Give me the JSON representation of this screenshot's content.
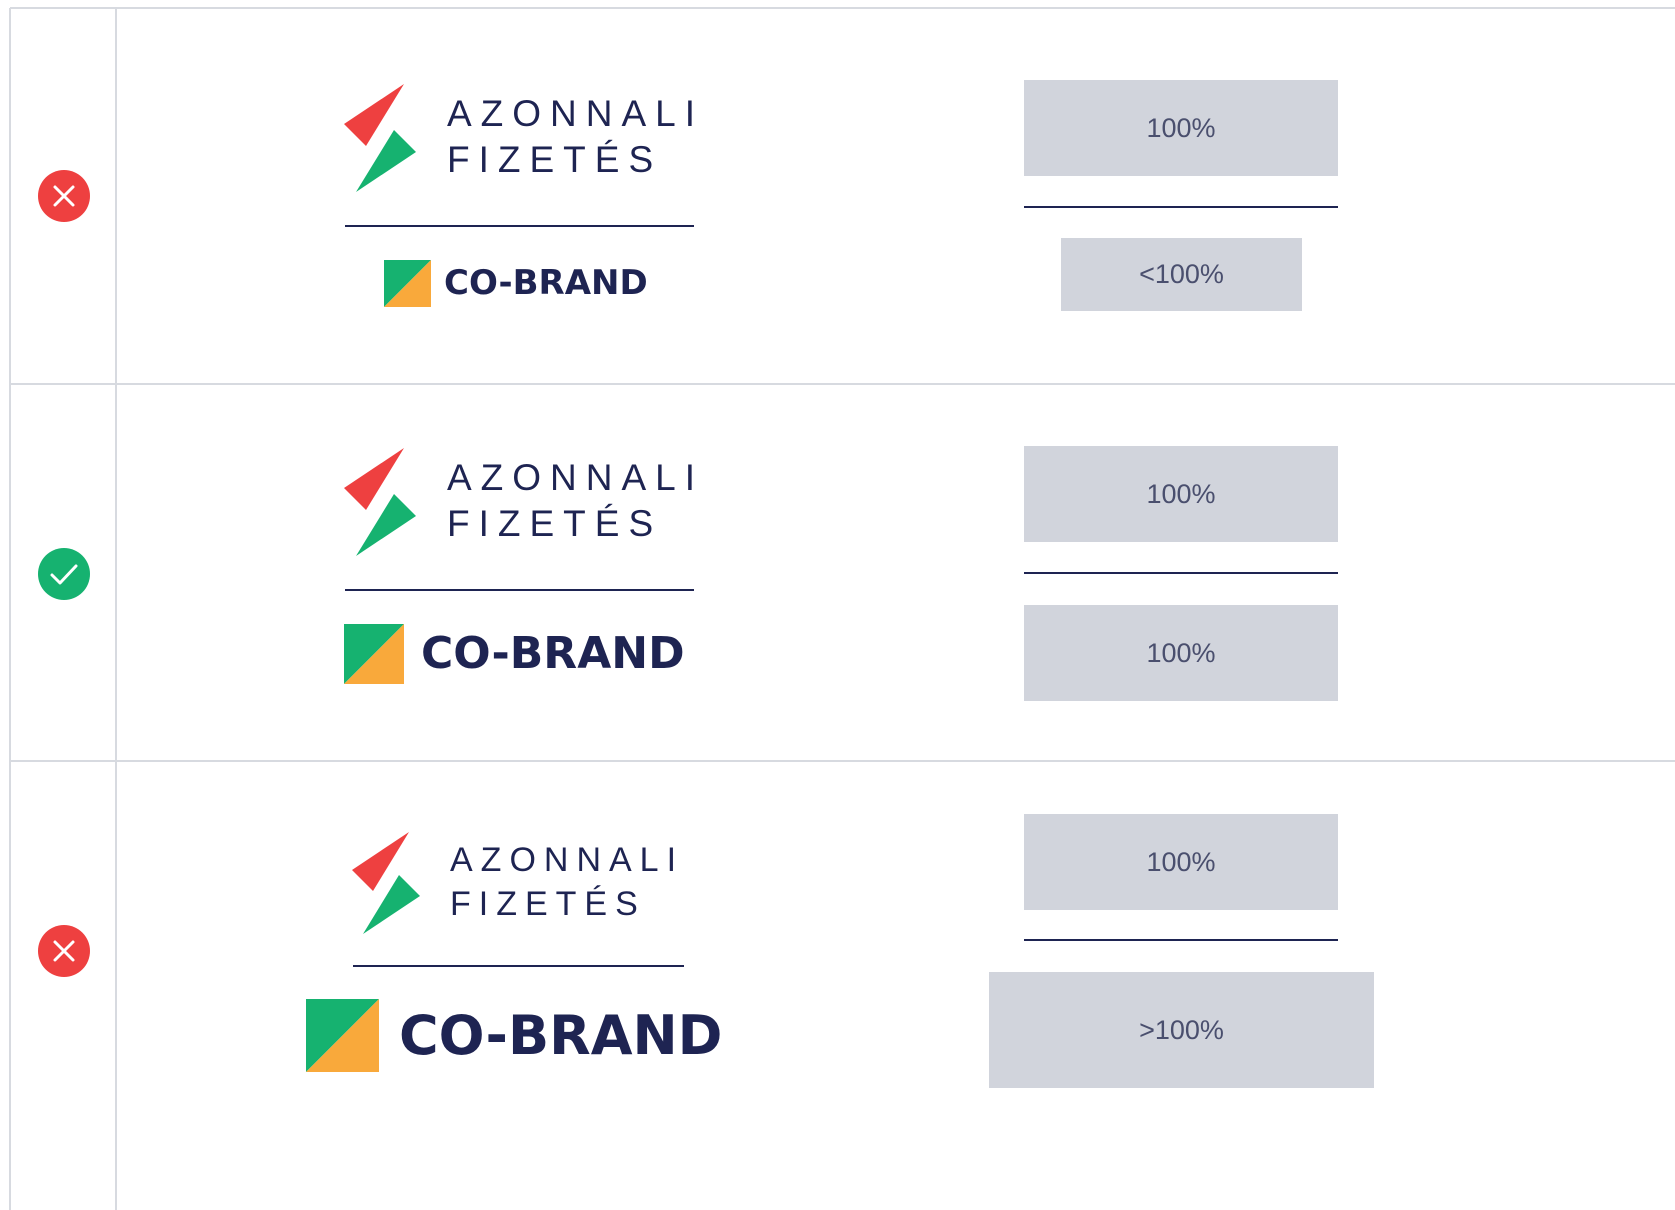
{
  "colors": {
    "error": "#ee4040",
    "success": "#16b270",
    "navy": "#1e2452",
    "box_fill": "#d1d4dc",
    "grid": "#d7dae0",
    "mark_red": "#ee4040",
    "mark_green": "#16b270",
    "mark_orange": "#f9a93b"
  },
  "rows": [
    {
      "status": "incorrect",
      "status_icon": "x-icon",
      "primary_logo": {
        "line1": "AZONNALI",
        "line2": "FIZETÉS"
      },
      "cobrand_text": "CO-BRAND",
      "box_top_label": "100%",
      "box_bottom_label": "<100%"
    },
    {
      "status": "correct",
      "status_icon": "check-icon",
      "primary_logo": {
        "line1": "AZONNALI",
        "line2": "FIZETÉS"
      },
      "cobrand_text": "CO-BRAND",
      "box_top_label": "100%",
      "box_bottom_label": "100%"
    },
    {
      "status": "incorrect",
      "status_icon": "x-icon",
      "primary_logo": {
        "line1": "AZONNALI",
        "line2": "FIZETÉS"
      },
      "cobrand_text": "CO-BRAND",
      "box_top_label": "100%",
      "box_bottom_label": ">100%"
    }
  ]
}
